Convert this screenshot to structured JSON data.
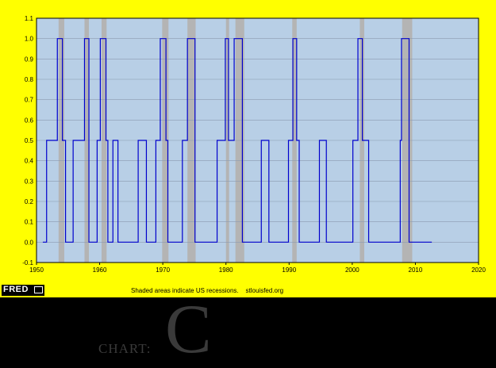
{
  "chart_data": {
    "type": "line",
    "title": "",
    "xlabel": "",
    "ylabel": "",
    "xlim": [
      1950,
      2020
    ],
    "ylim": [
      -0.1,
      1.1
    ],
    "x_ticks": [
      "1950",
      "1960",
      "1970",
      "1980",
      "1990",
      "2000",
      "2010",
      "2020"
    ],
    "y_ticks": [
      "-0.1",
      "0.0",
      "0.1",
      "0.2",
      "0.3",
      "0.4",
      "0.5",
      "0.6",
      "0.7",
      "0.8",
      "0.9",
      "1.0",
      "1.1"
    ],
    "grid": true,
    "legend": "none",
    "colors": {
      "page_background": "#ffff00",
      "plot_background": "#b8cfe6",
      "recession_band": "#b4b4b4",
      "series_line": "#0000cc",
      "grid_line": "#8a9bb0"
    },
    "recessions": [
      [
        1953.5,
        1954.4
      ],
      [
        1957.6,
        1958.3
      ],
      [
        1960.3,
        1961.1
      ],
      [
        1969.9,
        1970.9
      ],
      [
        1973.9,
        1975.2
      ],
      [
        1980.0,
        1980.5
      ],
      [
        1981.5,
        1982.9
      ],
      [
        1990.5,
        1991.2
      ],
      [
        2001.2,
        2001.9
      ],
      [
        2007.9,
        2009.5
      ]
    ],
    "series": [
      {
        "values": [
          [
            1951.0,
            0.0
          ],
          [
            1951.6,
            0.0
          ],
          [
            1951.6,
            0.5
          ],
          [
            1953.3,
            0.5
          ],
          [
            1953.3,
            1.0
          ],
          [
            1954.1,
            1.0
          ],
          [
            1954.1,
            0.5
          ],
          [
            1954.6,
            0.5
          ],
          [
            1954.6,
            0.0
          ],
          [
            1955.8,
            0.0
          ],
          [
            1955.8,
            0.5
          ],
          [
            1957.6,
            0.5
          ],
          [
            1957.6,
            1.0
          ],
          [
            1958.3,
            1.0
          ],
          [
            1958.3,
            0.0
          ],
          [
            1959.6,
            0.0
          ],
          [
            1959.6,
            0.5
          ],
          [
            1960.1,
            0.5
          ],
          [
            1960.1,
            1.0
          ],
          [
            1961.0,
            1.0
          ],
          [
            1961.0,
            0.5
          ],
          [
            1961.3,
            0.5
          ],
          [
            1961.3,
            0.0
          ],
          [
            1962.1,
            0.0
          ],
          [
            1962.1,
            0.5
          ],
          [
            1962.9,
            0.5
          ],
          [
            1962.9,
            0.0
          ],
          [
            1966.1,
            0.0
          ],
          [
            1966.1,
            0.5
          ],
          [
            1967.4,
            0.5
          ],
          [
            1967.4,
            0.0
          ],
          [
            1968.9,
            0.0
          ],
          [
            1968.9,
            0.5
          ],
          [
            1969.6,
            0.5
          ],
          [
            1969.6,
            1.0
          ],
          [
            1970.5,
            1.0
          ],
          [
            1970.5,
            0.5
          ],
          [
            1970.8,
            0.5
          ],
          [
            1970.8,
            0.0
          ],
          [
            1973.1,
            0.0
          ],
          [
            1973.1,
            0.5
          ],
          [
            1973.9,
            0.5
          ],
          [
            1973.9,
            1.0
          ],
          [
            1975.1,
            1.0
          ],
          [
            1975.1,
            0.0
          ],
          [
            1978.6,
            0.0
          ],
          [
            1978.6,
            0.5
          ],
          [
            1979.9,
            0.5
          ],
          [
            1979.9,
            1.0
          ],
          [
            1980.4,
            1.0
          ],
          [
            1980.4,
            0.5
          ],
          [
            1981.3,
            0.5
          ],
          [
            1981.3,
            1.0
          ],
          [
            1982.6,
            1.0
          ],
          [
            1982.6,
            0.0
          ],
          [
            1985.6,
            0.0
          ],
          [
            1985.6,
            0.5
          ],
          [
            1986.8,
            0.5
          ],
          [
            1986.8,
            0.0
          ],
          [
            1989.9,
            0.0
          ],
          [
            1989.9,
            0.5
          ],
          [
            1990.6,
            0.5
          ],
          [
            1990.6,
            1.0
          ],
          [
            1991.2,
            1.0
          ],
          [
            1991.2,
            0.5
          ],
          [
            1991.6,
            0.5
          ],
          [
            1991.6,
            0.0
          ],
          [
            1994.8,
            0.0
          ],
          [
            1994.8,
            0.5
          ],
          [
            1995.9,
            0.5
          ],
          [
            1995.9,
            0.0
          ],
          [
            2000.1,
            0.0
          ],
          [
            2000.1,
            0.5
          ],
          [
            2000.9,
            0.5
          ],
          [
            2000.9,
            1.0
          ],
          [
            2001.6,
            1.0
          ],
          [
            2001.6,
            0.5
          ],
          [
            2002.6,
            0.5
          ],
          [
            2002.6,
            0.0
          ],
          [
            2007.6,
            0.0
          ],
          [
            2007.6,
            0.5
          ],
          [
            2007.8,
            0.5
          ],
          [
            2007.8,
            1.0
          ],
          [
            2009.0,
            1.0
          ],
          [
            2009.0,
            0.0
          ],
          [
            2012.6,
            0.0
          ]
        ]
      }
    ]
  },
  "footer": {
    "note": "Shaded areas indicate US recessions.    stlouisfed.org",
    "logo_text": "FRED"
  },
  "watermark": {
    "small_text": "CHART:",
    "big_letter": "C"
  }
}
